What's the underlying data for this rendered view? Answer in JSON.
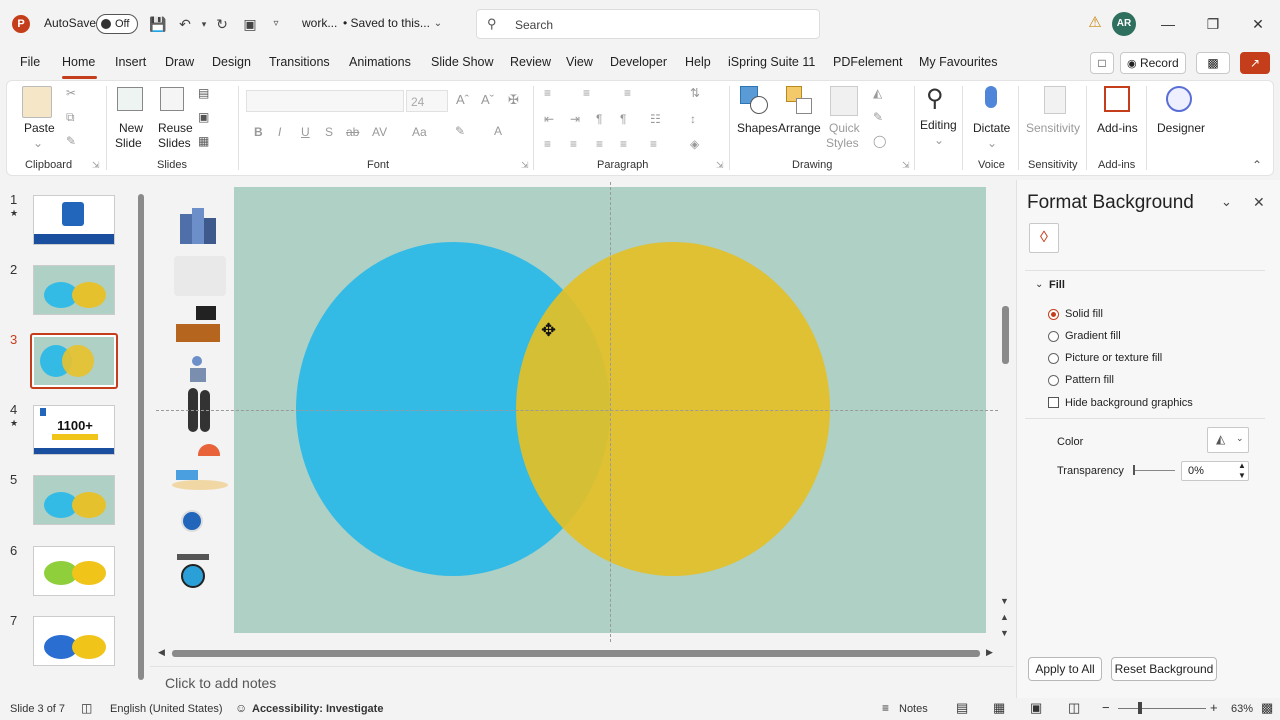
{
  "titlebar": {
    "autosave_label": "AutoSave",
    "autosave_state": "Off",
    "filename": "work...",
    "saved_status": "• Saved to this...",
    "search_placeholder": "Search",
    "avatar_initials": "AR"
  },
  "tabs": [
    "File",
    "Home",
    "Insert",
    "Draw",
    "Design",
    "Transitions",
    "Animations",
    "Slide Show",
    "Review",
    "View",
    "Developer",
    "Help",
    "iSpring Suite 11",
    "PDFelement",
    "My Favourites"
  ],
  "active_tab": "Home",
  "record_label": "Record",
  "ribbon": {
    "clipboard": {
      "paste": "Paste",
      "group": "Clipboard"
    },
    "slides": {
      "new_slide": "New",
      "new_slide2": "Slide",
      "reuse": "Reuse",
      "reuse2": "Slides",
      "group": "Slides"
    },
    "font": {
      "size": "24",
      "group": "Font"
    },
    "paragraph": {
      "group": "Paragraph"
    },
    "drawing": {
      "shapes": "Shapes",
      "arrange": "Arrange",
      "quick_styles": "Quick",
      "quick_styles2": "Styles",
      "group": "Drawing"
    },
    "editing": {
      "label": "Editing"
    },
    "voice": {
      "dictate": "Dictate",
      "group": "Voice"
    },
    "sensitivity": {
      "label": "Sensitivity",
      "group": "Sensitivity"
    },
    "addins": {
      "label": "Add-ins",
      "group": "Add-ins"
    },
    "designer": {
      "label": "Designer"
    }
  },
  "thumbnails": [
    {
      "num": "1",
      "star": "★"
    },
    {
      "num": "2",
      "star": ""
    },
    {
      "num": "3",
      "star": ""
    },
    {
      "num": "4",
      "star": "★",
      "text": "1100+"
    },
    {
      "num": "5",
      "star": ""
    },
    {
      "num": "6",
      "star": ""
    },
    {
      "num": "7",
      "star": ""
    }
  ],
  "slide": {
    "background": "#aed0c5",
    "left_circle_color": "#33bbe6",
    "right_circle_color": "#e6c12e"
  },
  "notes_placeholder": "Click to add notes",
  "pane": {
    "title": "Format Background",
    "section": "Fill",
    "options": [
      "Solid fill",
      "Gradient fill",
      "Picture or texture fill",
      "Pattern fill"
    ],
    "selected": "Solid fill",
    "hide_graphics": "Hide background graphics",
    "color_label": "Color",
    "transparency_label": "Transparency",
    "transparency_value": "0%",
    "apply_all": "Apply to All",
    "reset": "Reset Background"
  },
  "status": {
    "slide_info": "Slide 3 of 7",
    "language": "English (United States)",
    "accessibility": "Accessibility: Investigate",
    "notes": "Notes",
    "zoom": "63%"
  }
}
